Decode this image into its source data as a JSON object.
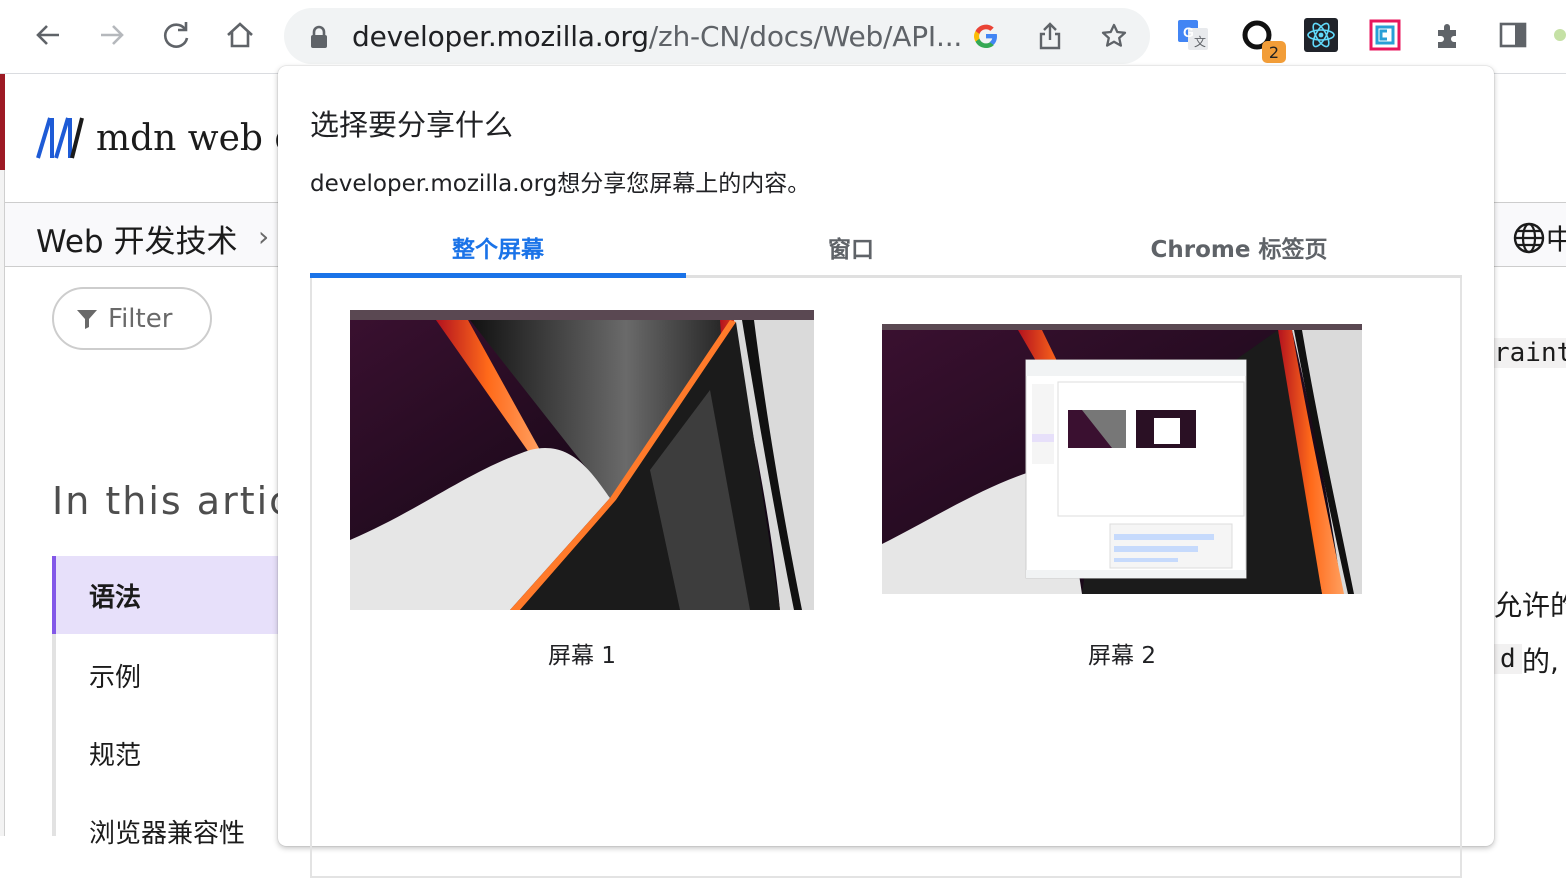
{
  "browser": {
    "url_host": "developer.mozilla.org",
    "url_path": "/zh-CN/docs/Web/API...",
    "extension_badge": "2"
  },
  "page": {
    "logo_text": "mdn web do",
    "breadcrumb": "Web 开发技术",
    "filter_label": "Filter",
    "toc_title": "In this artic",
    "toc_items": [
      "语法",
      "示例",
      "规范",
      "浏览器兼容性"
    ],
    "right_snippets": [
      "raint",
      "允许的",
      "d",
      "的,"
    ]
  },
  "dialog": {
    "title": "选择要分享什么",
    "subtitle": "developer.mozilla.org想分享您屏幕上的内容。",
    "tabs": [
      "整个屏幕",
      "窗口",
      "Chrome 标签页"
    ],
    "active_tab": "整个屏幕",
    "screens": [
      {
        "label": "屏幕 1"
      },
      {
        "label": "屏幕 2"
      }
    ]
  },
  "colors": {
    "accent": "#1a73e8",
    "mdn_blue": "#1e5bd6",
    "toc_active_bg": "#e7e0fa",
    "toc_active_border": "#8358e8"
  }
}
